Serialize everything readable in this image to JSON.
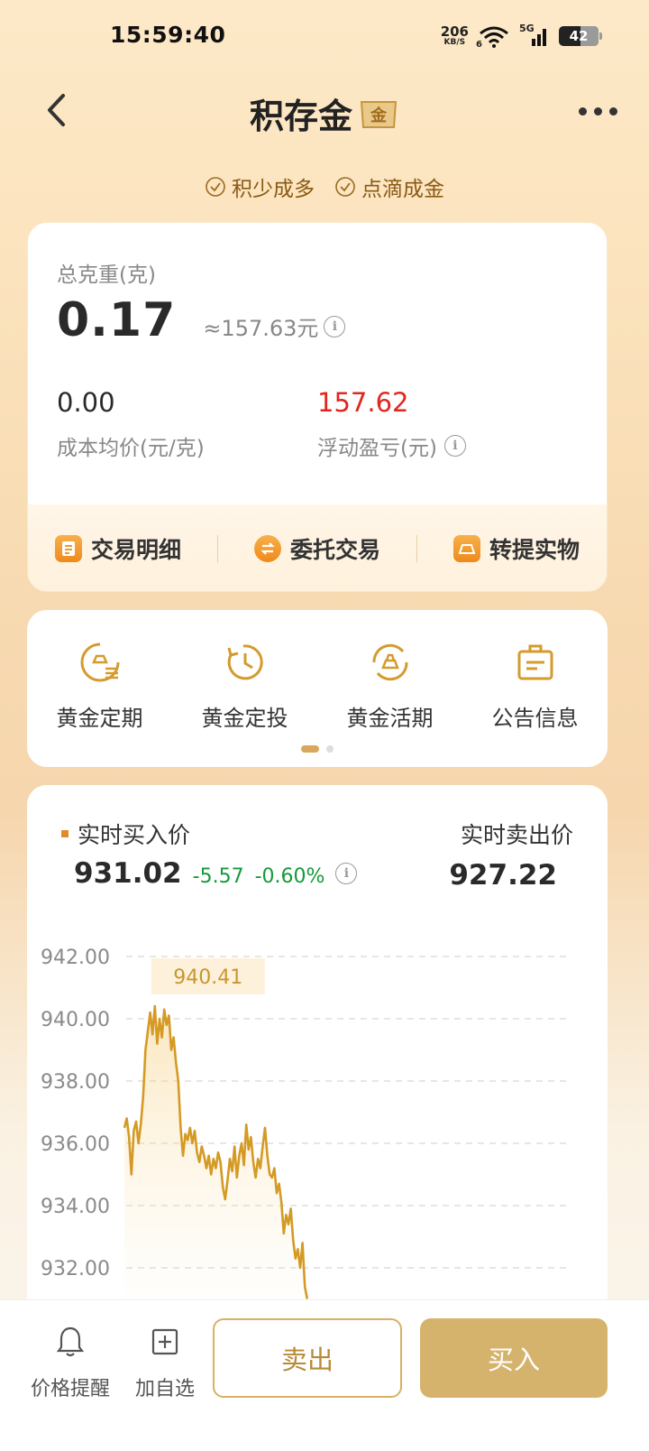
{
  "status_bar": {
    "time": "15:59:40",
    "net_speed_value": "206",
    "net_speed_unit": "KB/S",
    "wifi_label": "6",
    "cell_label": "5G",
    "battery": "42"
  },
  "nav": {
    "title": "积存金",
    "logo_text": "金"
  },
  "tags": [
    "积少成多",
    "点滴成金"
  ],
  "asset": {
    "total_weight_label": "总克重(克)",
    "total_weight": "0.17",
    "approx_value": "≈157.63元",
    "avg_cost_value": "0.00",
    "avg_cost_label": "成本均价(元/克)",
    "floating_pl_value": "157.62",
    "floating_pl_label": "浮动盈亏(元)"
  },
  "asset_actions": [
    {
      "label": "交易明细",
      "icon": "doc-icon"
    },
    {
      "label": "委托交易",
      "icon": "exchange-icon"
    },
    {
      "label": "转提实物",
      "icon": "gold-bar-icon"
    }
  ],
  "services": [
    {
      "label": "黄金定期",
      "icon": "gold-fixed-icon"
    },
    {
      "label": "黄金定投",
      "icon": "gold-invest-icon"
    },
    {
      "label": "黄金活期",
      "icon": "gold-current-icon"
    },
    {
      "label": "公告信息",
      "icon": "notice-icon"
    }
  ],
  "price": {
    "buy_label": "实时买入价",
    "buy_price": "931.02",
    "change": "-5.57",
    "change_pct": "-0.60%",
    "sell_label": "实时卖出价",
    "sell_price": "927.22"
  },
  "chart_data": {
    "type": "line",
    "title": "",
    "xlabel": "",
    "ylabel": "",
    "ylim": [
      931.0,
      942.0
    ],
    "y_ticks": [
      "942.00",
      "940.00",
      "938.00",
      "936.00",
      "934.00",
      "932.00"
    ],
    "y_tick_values": [
      942,
      940,
      938,
      936,
      934,
      932
    ],
    "grid": true,
    "max_label": "940.41",
    "series": [
      {
        "values": [
          936.5,
          936.8,
          936.2,
          935.0,
          936.4,
          936.7,
          936.0,
          936.6,
          937.5,
          939.0,
          939.6,
          940.2,
          939.5,
          940.41,
          939.2,
          940.0,
          939.4,
          940.3,
          939.8,
          940.1,
          939.0,
          939.4,
          938.6,
          938.0,
          936.5,
          935.6,
          936.3,
          936.1,
          936.5,
          936.0,
          936.4,
          935.7,
          935.4,
          935.9,
          935.6,
          935.2,
          935.6,
          935.0,
          935.5,
          935.2,
          935.7,
          935.4,
          934.6,
          934.2,
          934.8,
          935.5,
          935.1,
          935.9,
          934.9,
          935.6,
          936.0,
          935.3,
          936.6,
          935.8,
          936.2,
          935.4,
          934.9,
          935.5,
          935.2,
          935.9,
          936.5,
          935.6,
          935.0,
          934.9,
          935.2,
          934.4,
          934.7,
          934.1,
          933.1,
          933.7,
          933.4,
          933.9,
          932.9,
          932.3,
          932.6,
          932.0,
          932.8,
          931.4,
          931.0
        ]
      }
    ]
  },
  "bottom_bar": {
    "alert_label": "价格提醒",
    "watch_label": "加自选",
    "sell_label": "卖出",
    "buy_label": "买入"
  }
}
